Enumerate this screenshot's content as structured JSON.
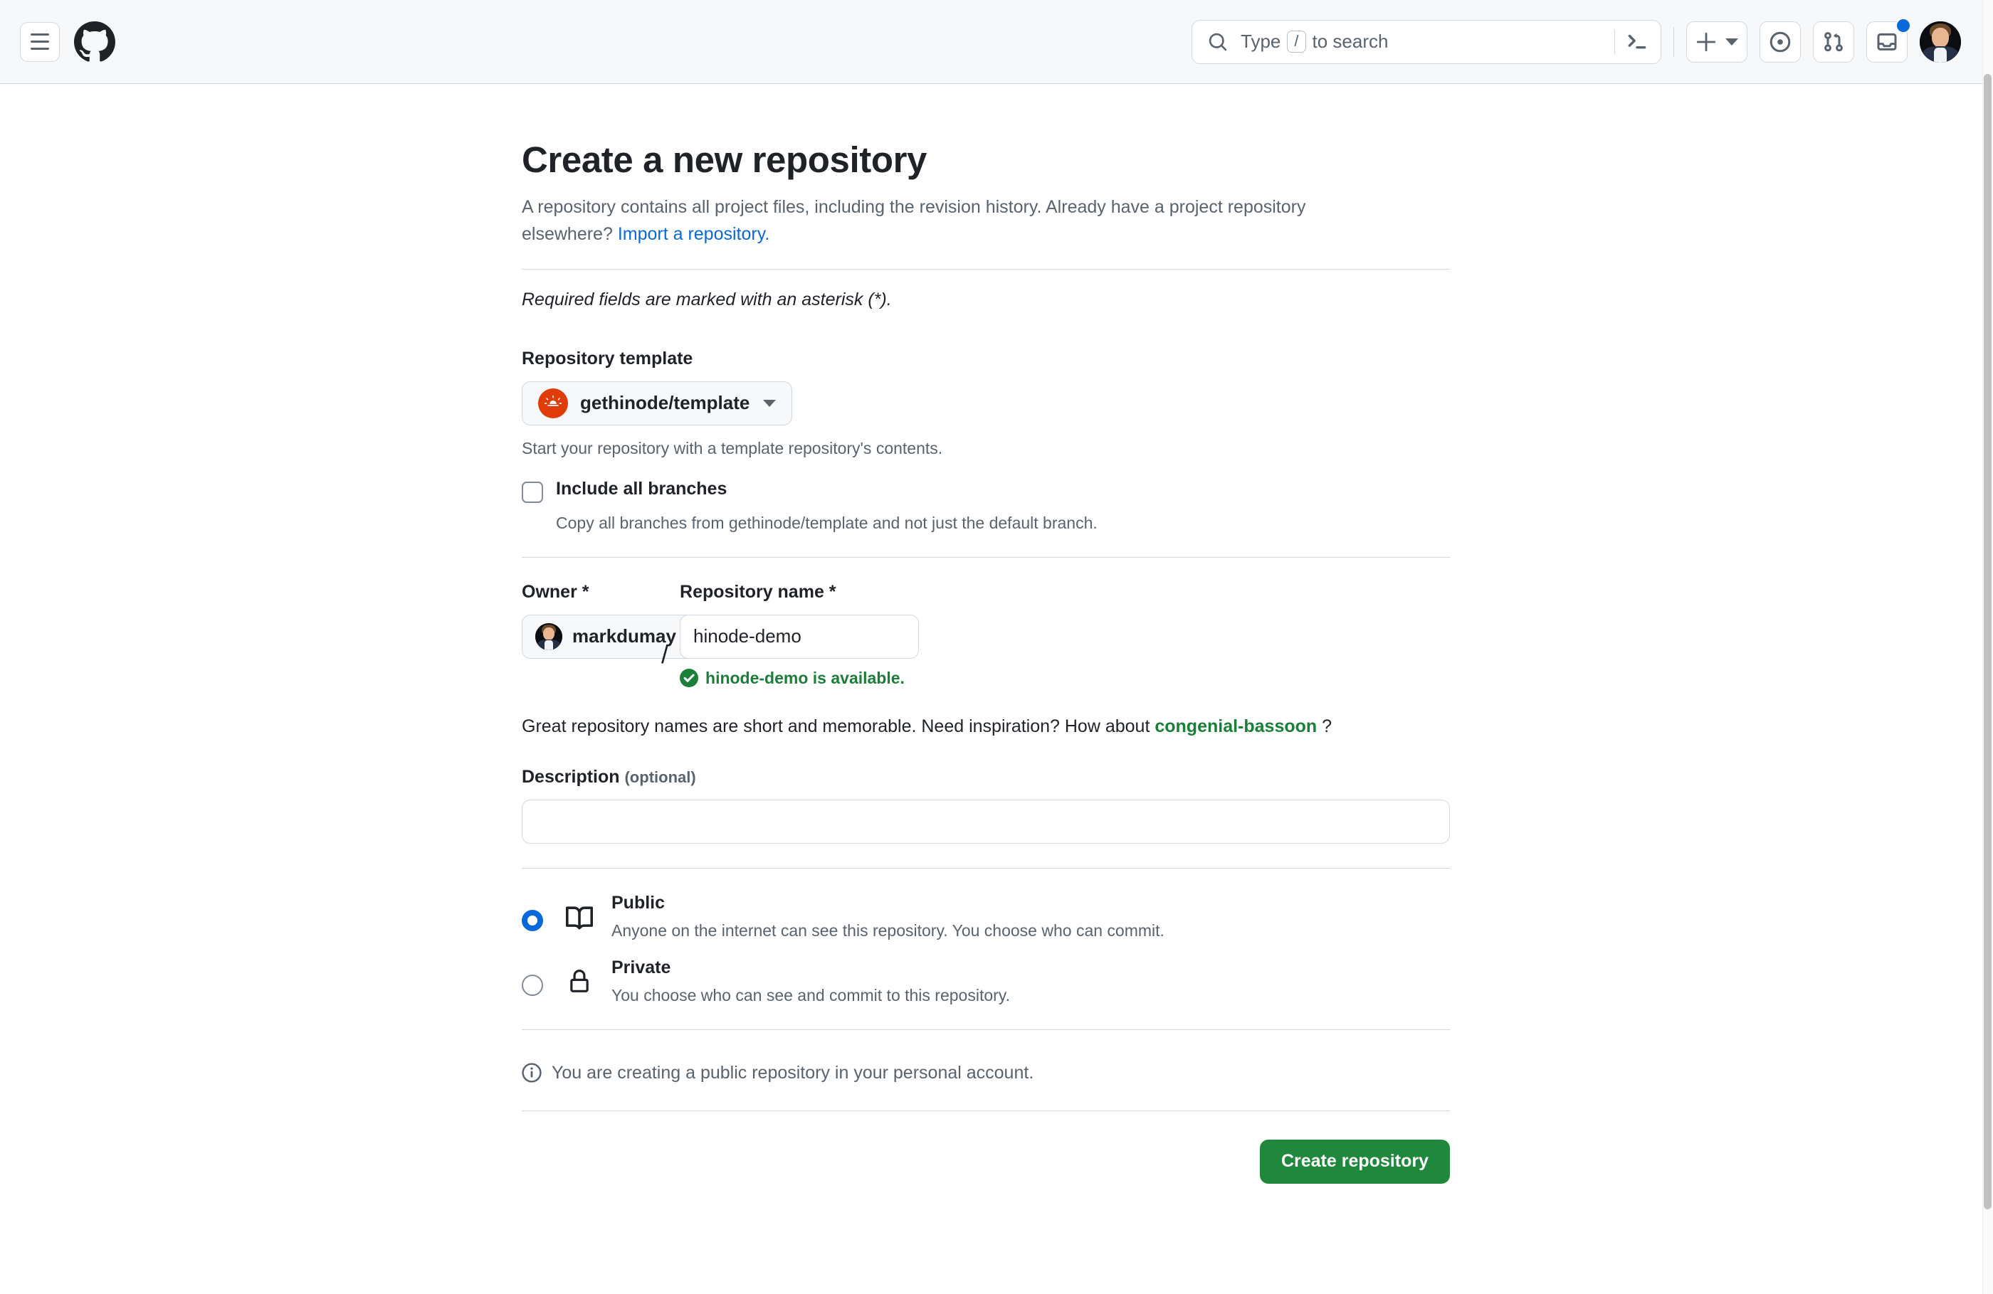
{
  "header": {
    "menu_label": "Open global navigation menu",
    "logo_label": "GitHub",
    "search": {
      "prefix": "Type",
      "key": "/",
      "suffix": "to search",
      "value": ""
    },
    "terminal_label": "Open Copilot command palette",
    "create_label": "Create new...",
    "issues_label": "Issues",
    "pull_requests_label": "Pull requests",
    "inbox_label": "Notifications",
    "has_notifications": true,
    "avatar_label": "markdumay"
  },
  "page": {
    "title": "Create a new repository",
    "description_1": "A repository contains all project files, including the revision history. Already have a project repository elsewhere?",
    "import_link": "Import a repository.",
    "required_note": "Required fields are marked with an asterisk (*)."
  },
  "template": {
    "label": "Repository template",
    "selected": "gethinode/template",
    "hint": "Start your repository with a template repository's contents.",
    "include_all_branches": {
      "label": "Include all branches",
      "hint": "Copy all branches from gethinode/template and not just the default branch.",
      "checked": false
    }
  },
  "owner": {
    "label": "Owner *",
    "selected": "markdumay"
  },
  "separator": "/",
  "repo_name": {
    "label": "Repository name *",
    "value": "hinode-demo",
    "placeholder": "",
    "availability": "hinode-demo is available.",
    "available_color": "#1a7f37"
  },
  "inspiration": {
    "prefix": "Great repository names are short and memorable. Need inspiration? How about",
    "suggestion": "congenial-bassoon",
    "suffix": "?"
  },
  "description": {
    "label": "Description",
    "optional": "(optional)",
    "value": "",
    "placeholder": ""
  },
  "visibility": {
    "options": [
      {
        "id": "public",
        "title": "Public",
        "subtitle": "Anyone on the internet can see this repository. You choose who can commit.",
        "icon": "book-icon",
        "selected": true
      },
      {
        "id": "private",
        "title": "Private",
        "subtitle": "You choose who can see and commit to this repository.",
        "icon": "lock-icon",
        "selected": false
      }
    ],
    "selected_color": "#0969da"
  },
  "footer": {
    "note": "You are creating a public repository in your personal account.",
    "submit_label": "Create repository",
    "submit_color": "#1f883d"
  }
}
